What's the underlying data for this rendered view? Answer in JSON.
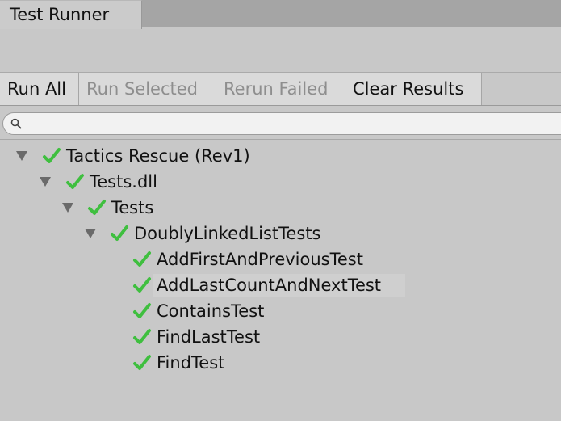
{
  "window": {
    "tab_title": "Test Runner"
  },
  "toolbar": {
    "run_all": "Run All",
    "run_selected": "Run Selected",
    "rerun_failed": "Rerun Failed",
    "clear_results": "Clear Results"
  },
  "search": {
    "value": "",
    "placeholder": ""
  },
  "colors": {
    "pass_check": "#3fbf3f",
    "disabled_text": "#8e8e8e"
  },
  "tree": {
    "items": [
      {
        "label": "Tactics Rescue (Rev1)",
        "status": "passed",
        "expanded": true,
        "level": 0
      },
      {
        "label": "Tests.dll",
        "status": "passed",
        "expanded": true,
        "level": 1
      },
      {
        "label": "Tests",
        "status": "passed",
        "expanded": true,
        "level": 2
      },
      {
        "label": "DoublyLinkedListTests",
        "status": "passed",
        "expanded": true,
        "level": 3
      },
      {
        "label": "AddFirstAndPreviousTest",
        "status": "passed",
        "level": 4
      },
      {
        "label": "AddLastCountAndNextTest",
        "status": "passed",
        "level": 4
      },
      {
        "label": "ContainsTest",
        "status": "passed",
        "level": 4
      },
      {
        "label": "FindLastTest",
        "status": "passed",
        "level": 4
      },
      {
        "label": "FindTest",
        "status": "passed",
        "level": 4
      }
    ]
  }
}
